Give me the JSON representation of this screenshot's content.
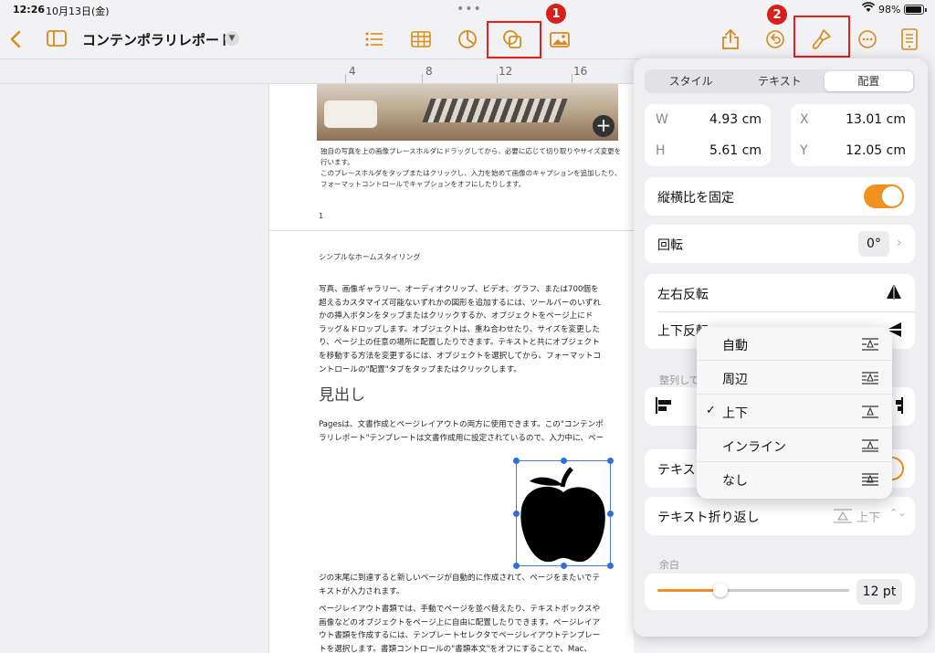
{
  "status_bar": {
    "time": "12:26",
    "date": "10月13日(金)",
    "battery": "98%"
  },
  "toolbar": {
    "document_title": "コンテンポラリレポート",
    "badge1": "1",
    "badge2": "2"
  },
  "ruler": {
    "ticks": [
      "4",
      "8",
      "12",
      "16"
    ]
  },
  "document": {
    "caption_lines": [
      "独自の写真を上の画像プレースホルダにドラッグしてから、必要に応じて切り取りやサイズ変更を",
      "行います。",
      "このプレースホルダをタップまたはクリックし、入力を始めて画像のキャプションを追加したり、",
      "フォーマットコントロールでキャプションをオフにしたりします。"
    ],
    "page_number": "1",
    "page_header": "シンプルなホームスタイリング",
    "paragraph1": [
      "写真、画像ギャラリー、オーディオクリップ、ビデオ、グラフ、または700個を",
      "超えるカスタマイズ可能ないずれかの図形を追加するには、ツールバーのいずれ",
      "かの挿入ボタンをタップまたはクリックするか、オブジェクトをページ上にド",
      "ラッグ＆ドロップします。オブジェクトは、重ね合わせたり、サイズを変更した",
      "り、ページ上の任意の場所に配置したりできます。テキストと共にオブジェクト",
      "を移動する方法を変更するには、オブジェクトを選択してから、フォーマットコ",
      "ントロールの\"配置\"タブをタップまたはクリックします。"
    ],
    "heading": "見出し",
    "paragraph2": [
      "Pagesは、文書作成とページレイアウトの両方に使用できます。この\"コンテンポ",
      "ラリレポート\"テンプレートは文書作成用に設定されているので、入力中に、ペー"
    ],
    "paragraph3": [
      "ジの末尾に到達すると新しいページが自動的に作成されて、ページをまたいでテ",
      "キストが入力されます。"
    ],
    "paragraph4": [
      "ページレイアウト書類では、手動でページを並べ替えたり、テキストボックスや",
      "画像などのオブジェクトをページ上に自由に配置したりできます。ページレイア",
      "ウト書類を作成するには、テンプレートセレクタでページレイアウトテンプレー",
      "トを選択します。書類コントロールの\"書類本文\"をオフにすることで、Mac、"
    ]
  },
  "panel": {
    "tabs": [
      "スタイル",
      "テキスト",
      "配置"
    ],
    "active_tab": "配置",
    "w_label": "W",
    "w_value": "4.93 cm",
    "h_label": "H",
    "h_value": "5.61 cm",
    "x_label": "X",
    "x_value": "13.01 cm",
    "y_label": "Y",
    "y_value": "12.05 cm",
    "lock_aspect": "縦横比を固定",
    "rotate": "回転",
    "rotate_value": "0°",
    "flip_h": "左右反転",
    "flip_v": "上下反転",
    "align_caption": "整列して",
    "text_row_partial": "テキス",
    "text_wrap": "テキスト折り返し",
    "text_wrap_value": "上下",
    "margin_caption": "余白",
    "margin_value": "12 pt",
    "margin_slider_fraction": 0.33,
    "accent_color": "#f0901e"
  },
  "wrap_menu": {
    "items": [
      "自動",
      "周辺",
      "上下",
      "インライン",
      "なし"
    ],
    "selected": "上下"
  }
}
